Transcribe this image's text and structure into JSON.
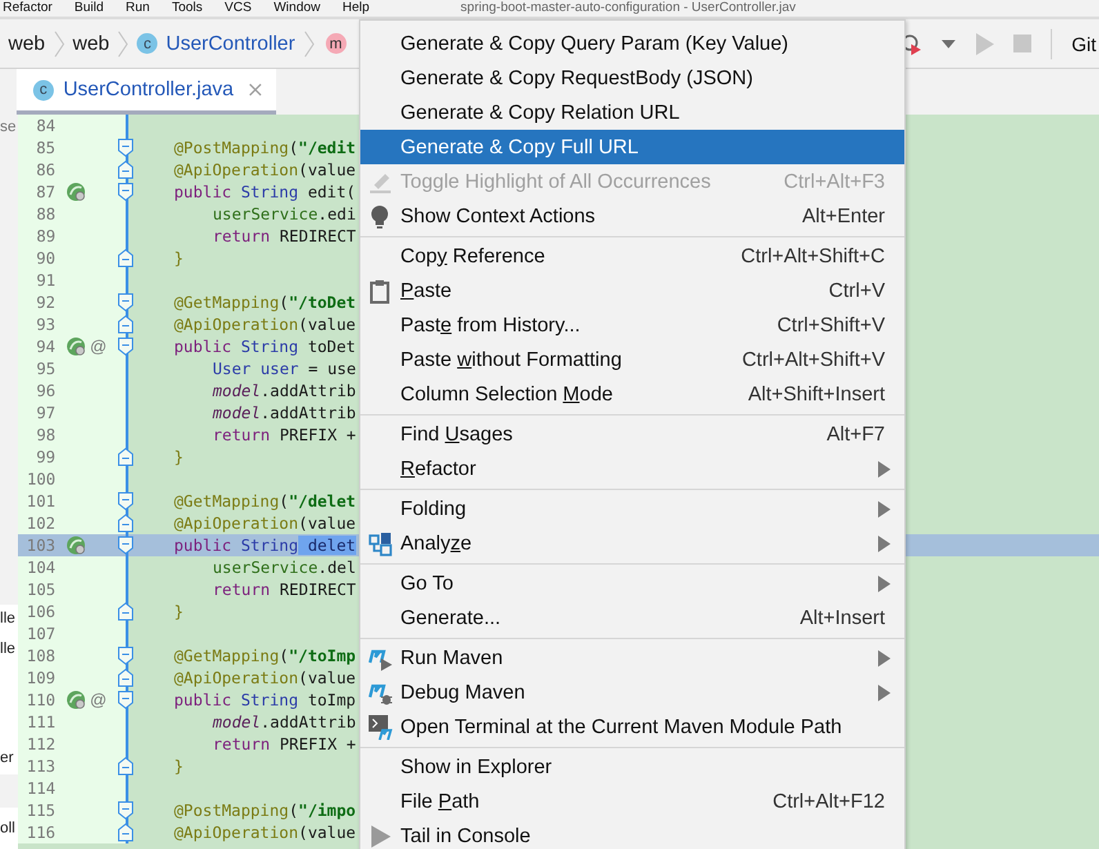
{
  "menubar": {
    "items": [
      "Refactor",
      "Build",
      "Run",
      "Tools",
      "VCS",
      "Window",
      "Help"
    ],
    "title": "spring-boot-master-auto-configuration - UserController.jav"
  },
  "breadcrumbs": [
    {
      "kind": "plain",
      "label": "web"
    },
    {
      "kind": "plain",
      "label": "web"
    },
    {
      "kind": "class",
      "badge": "c",
      "label": "UserController"
    },
    {
      "kind": "method",
      "badge": "m"
    }
  ],
  "toolbar": {
    "label": "Git"
  },
  "tab": {
    "badge": "c",
    "label": "UserController.java",
    "selected": true
  },
  "side_fragments": [
    "se",
    "lle",
    "lle",
    "er",
    "oll"
  ],
  "editor": {
    "lines": [
      {
        "number": "84",
        "selected": false,
        "kind": "plain"
      },
      {
        "number": "85",
        "selected": false,
        "kind": "fold-start",
        "code": [
          {
            "kind": "ann",
            "text": "@PostMapping"
          },
          {
            "kind": "plain",
            "text": "("
          },
          {
            "kind": "str",
            "text": "\"/edit"
          }
        ]
      },
      {
        "number": "86",
        "selected": false,
        "kind": "fold-end",
        "code": [
          {
            "kind": "ann",
            "text": "@ApiOperation"
          },
          {
            "kind": "plain",
            "text": "(value"
          }
        ]
      },
      {
        "number": "87",
        "selected": false,
        "kind": "fold-start",
        "marker": true,
        "code": [
          {
            "kind": "kw",
            "text": "public"
          },
          {
            "kind": "type",
            "text": " String"
          },
          {
            "kind": "plain",
            "text": " edit("
          }
        ]
      },
      {
        "number": "88",
        "selected": false,
        "kind": "plain",
        "indented": true,
        "code": [
          {
            "kind": "field",
            "text": "userService"
          },
          {
            "kind": "plain",
            "text": ".edi"
          }
        ]
      },
      {
        "number": "89",
        "selected": false,
        "kind": "plain",
        "indented": true,
        "code": [
          {
            "kind": "kw",
            "text": "return"
          },
          {
            "kind": "plain",
            "text": " REDIRECT"
          }
        ]
      },
      {
        "number": "90",
        "selected": false,
        "kind": "fold-end",
        "code": [
          {
            "kind": "brace",
            "text": "}"
          }
        ]
      },
      {
        "number": "91",
        "selected": false,
        "kind": "plain"
      },
      {
        "number": "92",
        "selected": false,
        "kind": "fold-start",
        "code": [
          {
            "kind": "ann",
            "text": "@GetMapping"
          },
          {
            "kind": "plain",
            "text": "("
          },
          {
            "kind": "str",
            "text": "\"/toDet"
          }
        ]
      },
      {
        "number": "93",
        "selected": false,
        "kind": "fold-end",
        "code": [
          {
            "kind": "ann",
            "text": "@ApiOperation"
          },
          {
            "kind": "plain",
            "text": "(value"
          }
        ]
      },
      {
        "number": "94",
        "selected": false,
        "kind": "fold-start",
        "marker": true,
        "at": "@",
        "code": [
          {
            "kind": "kw",
            "text": "public"
          },
          {
            "kind": "type",
            "text": " String"
          },
          {
            "kind": "plain",
            "text": " toDet"
          }
        ]
      },
      {
        "number": "95",
        "selected": false,
        "kind": "plain",
        "indented": true,
        "code": [
          {
            "kind": "type",
            "text": "User"
          },
          {
            "kind": "type",
            "text": " user"
          },
          {
            "kind": "plain",
            "text": " = use"
          }
        ]
      },
      {
        "number": "96",
        "selected": false,
        "kind": "plain",
        "indented": true,
        "code": [
          {
            "kind": "ital",
            "text": "model"
          },
          {
            "kind": "plain",
            "text": ".addAttrib"
          }
        ]
      },
      {
        "number": "97",
        "selected": false,
        "kind": "plain",
        "indented": true,
        "code": [
          {
            "kind": "ital",
            "text": "model"
          },
          {
            "kind": "plain",
            "text": ".addAttrib"
          }
        ]
      },
      {
        "number": "98",
        "selected": false,
        "kind": "plain",
        "indented": true,
        "code": [
          {
            "kind": "kw",
            "text": "return"
          },
          {
            "kind": "plain",
            "text": " PREFIX +"
          }
        ]
      },
      {
        "number": "99",
        "selected": false,
        "kind": "fold-end",
        "code": [
          {
            "kind": "brace",
            "text": "}"
          }
        ]
      },
      {
        "number": "100",
        "selected": false,
        "kind": "plain"
      },
      {
        "number": "101",
        "selected": false,
        "kind": "fold-start",
        "code": [
          {
            "kind": "ann",
            "text": "@GetMapping"
          },
          {
            "kind": "plain",
            "text": "("
          },
          {
            "kind": "str",
            "text": "\"/delet"
          }
        ]
      },
      {
        "number": "102",
        "selected": false,
        "kind": "fold-end",
        "code": [
          {
            "kind": "ann",
            "text": "@ApiOperation"
          },
          {
            "kind": "plain",
            "text": "(value"
          }
        ]
      },
      {
        "number": "103",
        "selected": true,
        "kind": "fold-start",
        "marker": true,
        "code": [
          {
            "kind": "kw",
            "text": "public"
          },
          {
            "kind": "type",
            "text": " String"
          },
          {
            "kind": "sel",
            "text": " delet"
          }
        ]
      },
      {
        "number": "104",
        "selected": false,
        "kind": "plain",
        "indented": true,
        "code": [
          {
            "kind": "field",
            "text": "userService"
          },
          {
            "kind": "plain",
            "text": ".del"
          }
        ]
      },
      {
        "number": "105",
        "selected": false,
        "kind": "plain",
        "indented": true,
        "code": [
          {
            "kind": "kw",
            "text": "return"
          },
          {
            "kind": "plain",
            "text": " REDIRECT"
          }
        ]
      },
      {
        "number": "106",
        "selected": false,
        "kind": "fold-end",
        "code": [
          {
            "kind": "brace",
            "text": "}"
          }
        ]
      },
      {
        "number": "107",
        "selected": false,
        "kind": "plain"
      },
      {
        "number": "108",
        "selected": false,
        "kind": "fold-start",
        "code": [
          {
            "kind": "ann",
            "text": "@GetMapping"
          },
          {
            "kind": "plain",
            "text": "("
          },
          {
            "kind": "str",
            "text": "\"/toImp"
          }
        ]
      },
      {
        "number": "109",
        "selected": false,
        "kind": "fold-end",
        "code": [
          {
            "kind": "ann",
            "text": "@ApiOperation"
          },
          {
            "kind": "plain",
            "text": "(value"
          }
        ]
      },
      {
        "number": "110",
        "selected": false,
        "kind": "fold-start",
        "marker": true,
        "at": "@",
        "code": [
          {
            "kind": "kw",
            "text": "public"
          },
          {
            "kind": "type",
            "text": " String"
          },
          {
            "kind": "plain",
            "text": " toImp"
          }
        ]
      },
      {
        "number": "111",
        "selected": false,
        "kind": "plain",
        "indented": true,
        "code": [
          {
            "kind": "ital",
            "text": "model"
          },
          {
            "kind": "plain",
            "text": ".addAttrib"
          }
        ]
      },
      {
        "number": "112",
        "selected": false,
        "kind": "plain",
        "indented": true,
        "code": [
          {
            "kind": "kw",
            "text": "return"
          },
          {
            "kind": "plain",
            "text": " PREFIX +"
          }
        ]
      },
      {
        "number": "113",
        "selected": false,
        "kind": "fold-end",
        "code": [
          {
            "kind": "brace",
            "text": "}"
          }
        ]
      },
      {
        "number": "114",
        "selected": false,
        "kind": "plain"
      },
      {
        "number": "115",
        "selected": false,
        "kind": "fold-start",
        "code": [
          {
            "kind": "ann",
            "text": "@PostMapping"
          },
          {
            "kind": "plain",
            "text": "("
          },
          {
            "kind": "str",
            "text": "\"/impo"
          }
        ]
      },
      {
        "number": "116",
        "selected": false,
        "kind": "fold-end",
        "code": [
          {
            "kind": "ann",
            "text": "@ApiOperation"
          },
          {
            "kind": "plain",
            "text": "(value"
          }
        ]
      }
    ]
  },
  "context_menu": {
    "groups": [
      [
        {
          "kind": "plain",
          "label": "Generate & Copy Query Param (Key Value)",
          "selected": false,
          "disabled": false,
          "submenu": false
        },
        {
          "kind": "plain",
          "label": "Generate & Copy RequestBody (JSON)",
          "selected": false,
          "disabled": false,
          "submenu": false
        },
        {
          "kind": "plain",
          "label": "Generate & Copy Relation URL",
          "selected": false,
          "disabled": false,
          "submenu": false
        },
        {
          "kind": "plain",
          "label": "Generate & Copy Full URL",
          "selected": true,
          "disabled": false,
          "submenu": false
        },
        {
          "kind": "pencil",
          "label": "Toggle Highlight of All Occurrences",
          "shortcut": "Ctrl+Alt+F3",
          "selected": false,
          "disabled": true,
          "submenu": false
        },
        {
          "kind": "bulb",
          "label": "Show Context Actions",
          "shortcut": "Alt+Enter",
          "selected": false,
          "disabled": false,
          "submenu": false
        }
      ],
      [
        {
          "kind": "plain",
          "label": [
            "Cop",
            "y",
            " Reference"
          ],
          "shortcut": "Ctrl+Alt+Shift+C",
          "selected": false,
          "disabled": false,
          "submenu": false
        },
        {
          "kind": "clipboard",
          "label": {
            "key": "P",
            "after": "aste"
          },
          "shortcut": "Ctrl+V",
          "selected": false,
          "disabled": false,
          "submenu": false
        },
        {
          "kind": "plain",
          "label": [
            "Past",
            "e",
            " from History..."
          ],
          "shortcut": "Ctrl+Shift+V",
          "selected": false,
          "disabled": false,
          "submenu": false
        },
        {
          "kind": "plain",
          "label": [
            "Paste ",
            "w",
            "ithout Formatting"
          ],
          "shortcut": "Ctrl+Alt+Shift+V",
          "selected": false,
          "disabled": false,
          "submenu": false
        },
        {
          "kind": "plain",
          "label": [
            "Column Selection ",
            "M",
            "ode"
          ],
          "shortcut": "Alt+Shift+Insert",
          "selected": false,
          "disabled": false,
          "submenu": false
        }
      ],
      [
        {
          "kind": "plain",
          "label": [
            "Find ",
            "U",
            "sages"
          ],
          "shortcut": "Alt+F7",
          "selected": false,
          "disabled": false,
          "submenu": false
        },
        {
          "kind": "plain",
          "label": {
            "key": "R",
            "after": "efactor"
          },
          "selected": false,
          "disabled": false,
          "submenu": true
        }
      ],
      [
        {
          "kind": "plain",
          "label": "Folding",
          "selected": false,
          "disabled": false,
          "submenu": true
        },
        {
          "kind": "analyze",
          "label": [
            "Analy",
            "z",
            "e"
          ],
          "selected": false,
          "disabled": false,
          "submenu": true
        }
      ],
      [
        {
          "kind": "plain",
          "label": "Go To",
          "selected": false,
          "disabled": false,
          "submenu": true
        },
        {
          "kind": "plain",
          "label": "Generate...",
          "shortcut": "Alt+Insert",
          "selected": false,
          "disabled": false,
          "submenu": false
        }
      ],
      [
        {
          "kind": "mrun",
          "label": "Run Maven",
          "selected": false,
          "disabled": false,
          "submenu": true
        },
        {
          "kind": "mdebug",
          "label": "Debug Maven",
          "selected": false,
          "disabled": false,
          "submenu": true
        },
        {
          "kind": "mterm",
          "label": "Open Terminal at the Current Maven Module Path",
          "selected": false,
          "disabled": false,
          "submenu": false
        }
      ],
      [
        {
          "kind": "plain",
          "label": "Show in Explorer",
          "selected": false,
          "disabled": false,
          "submenu": false
        },
        {
          "kind": "plain",
          "label": [
            "File ",
            "P",
            "ath"
          ],
          "shortcut": "Ctrl+Alt+F12",
          "selected": false,
          "disabled": false,
          "submenu": false
        },
        {
          "kind": "tail",
          "label": "Tail in Console",
          "selected": false,
          "disabled": false,
          "submenu": false
        }
      ]
    ]
  }
}
